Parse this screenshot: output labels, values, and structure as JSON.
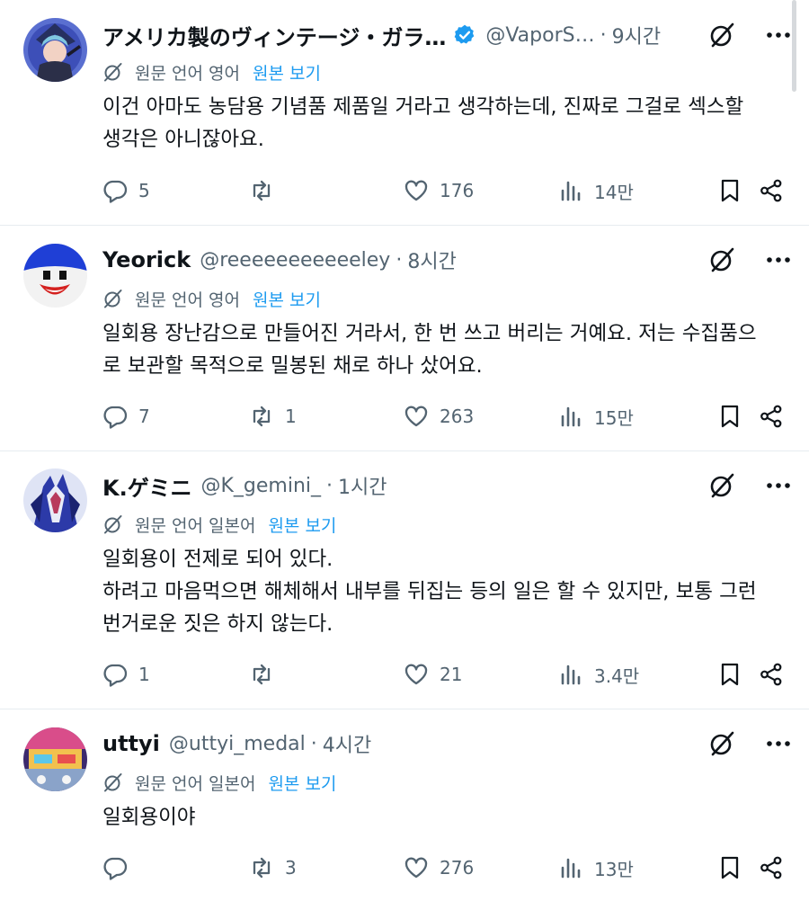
{
  "posts": [
    {
      "name": "アメリカ製のヴィンテージ・ガラ…",
      "verified": true,
      "handle": "@VaporS…",
      "time": "9시간",
      "translate_label": "원문 언어 영어",
      "show_original": "원본 보기",
      "lines": [
        "이건 아마도 농담용 기념품 제품일 거라고 생각하는데, 진짜로 그걸로 섹스할",
        "생각은 아니잖아요."
      ],
      "reply_count": "5",
      "repost_count": "",
      "like_count": "176",
      "view_count": "14만"
    },
    {
      "name": "Yeorick",
      "verified": false,
      "handle": "@reeeeeeeeeeeley",
      "time": "8시간",
      "translate_label": "원문 언어 영어",
      "show_original": "원본 보기",
      "lines": [
        "일회용 장난감으로 만들어진 거라서, 한 번 쓰고 버리는 거예요. 저는 수집품으",
        "로 보관할 목적으로 밀봉된 채로 하나 샀어요."
      ],
      "reply_count": "7",
      "repost_count": "1",
      "like_count": "263",
      "view_count": "15만"
    },
    {
      "name": "K.ゲミニ",
      "verified": false,
      "handle": "@K_gemini_",
      "time": "1시간",
      "translate_label": "원문 언어 일본어",
      "show_original": "원본 보기",
      "lines": [
        "일회용이 전제로 되어 있다.",
        "하려고 마음먹으면 해체해서 내부를 뒤집는 등의 일은 할 수 있지만, 보통 그런",
        "번거로운 짓은 하지 않는다."
      ],
      "reply_count": "1",
      "repost_count": "",
      "like_count": "21",
      "view_count": "3.4만"
    },
    {
      "name": "uttyi",
      "verified": false,
      "handle": "@uttyi_medal",
      "time": "4시간",
      "translate_label": "원문 언어 일본어",
      "show_original": "원본 보기",
      "lines": [
        "일회용이야"
      ],
      "reply_count": "",
      "repost_count": "3",
      "like_count": "276",
      "view_count": "13만"
    }
  ],
  "colors": {
    "text": "#0f1419",
    "secondary": "#536471",
    "link": "#1d9bf0",
    "divider": "#e6ecf0",
    "verified": "#1d9bf0"
  },
  "icons": [
    "verified-badge-icon",
    "grok-icon",
    "more-icon",
    "translate-icon",
    "reply-icon",
    "repost-icon",
    "like-icon",
    "views-icon",
    "bookmark-icon",
    "share-icon"
  ]
}
